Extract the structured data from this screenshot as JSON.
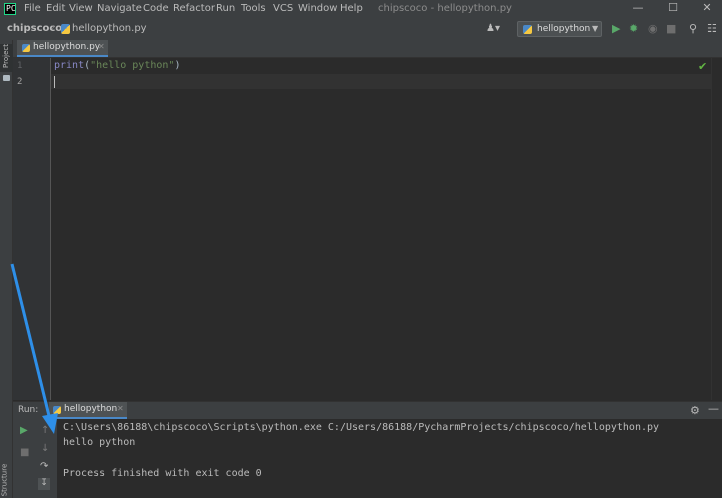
{
  "menu": {
    "items": [
      "File",
      "Edit",
      "View",
      "Navigate",
      "Code",
      "Refactor",
      "Run",
      "Tools",
      "VCS",
      "Window",
      "Help"
    ],
    "window_title": "chipscoco - hellopython.py"
  },
  "window_controls": {
    "minimize": "—",
    "maximize": "☐",
    "close": "✕"
  },
  "navbar": {
    "project": "chipscoco",
    "separator": "›",
    "file": "hellopython.py",
    "run_config": "hellopython"
  },
  "toolbar": {
    "user_icon": "user-icon",
    "run_icon": "run-icon",
    "debug_icon": "debug-icon",
    "coverage_icon": "coverage-icon",
    "stop_icon": "stop-icon",
    "search_icon": "search-icon"
  },
  "left_strip": {
    "project": "Project",
    "structure": "Structure"
  },
  "editor": {
    "tab": "hellopython.py",
    "line_numbers": [
      "1",
      "2"
    ],
    "code": {
      "fn": "print",
      "open": "(",
      "str": "\"hello python\"",
      "close": ")"
    }
  },
  "run_window": {
    "label": "Run:",
    "tab": "hellopython",
    "console": [
      "C:\\Users\\86188\\chipscoco\\Scripts\\python.exe C:/Users/86188/PycharmProjects/chipscoco/hellopython.py",
      "hello python",
      "",
      "Process finished with exit code 0"
    ]
  },
  "colors": {
    "background": "#2b2b2b",
    "chrome": "#3c3f41",
    "run_green": "#59a869",
    "annotation_arrow": "#2e8fe8"
  }
}
